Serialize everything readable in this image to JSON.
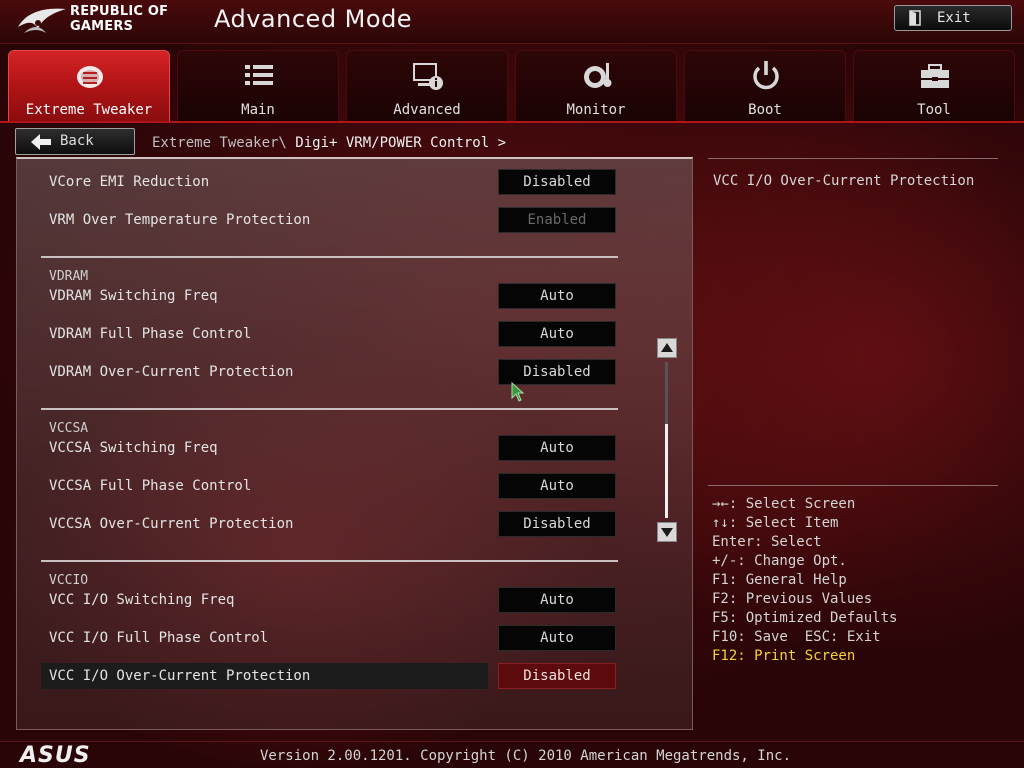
{
  "header": {
    "brand_line1": "REPUBLIC OF",
    "brand_line2": "GAMERS",
    "title": "Advanced Mode",
    "exit_label": "Exit"
  },
  "tabs": [
    {
      "label": "Extreme Tweaker",
      "icon": "extreme-tweaker-icon",
      "active": true
    },
    {
      "label": "Main",
      "icon": "list-icon",
      "active": false
    },
    {
      "label": "Advanced",
      "icon": "advanced-settings-icon",
      "active": false
    },
    {
      "label": "Monitor",
      "icon": "monitor-gauge-icon",
      "active": false
    },
    {
      "label": "Boot",
      "icon": "power-icon",
      "active": false
    },
    {
      "label": "Tool",
      "icon": "toolbox-icon",
      "active": false
    }
  ],
  "nav": {
    "back_label": "Back",
    "breadcrumb_parent": "Extreme Tweaker\\ ",
    "breadcrumb_current": "Digi+ VRM/POWER Control >"
  },
  "settings": {
    "vcore": [
      {
        "label": "VCore EMI Reduction",
        "value": "Disabled",
        "enabled": true
      },
      {
        "label": "VRM Over Temperature Protection",
        "value": "Enabled",
        "enabled": false
      }
    ],
    "vdram_group": "VDRAM",
    "vdram": [
      {
        "label": "VDRAM Switching Freq",
        "value": "Auto"
      },
      {
        "label": "VDRAM Full Phase Control",
        "value": "Auto"
      },
      {
        "label": "VDRAM Over-Current Protection",
        "value": "Disabled"
      }
    ],
    "vccsa_group": "VCCSA",
    "vccsa": [
      {
        "label": "VCCSA Switching Freq",
        "value": "Auto"
      },
      {
        "label": "VCCSA Full Phase Control",
        "value": "Auto"
      },
      {
        "label": "VCCSA Over-Current Protection",
        "value": "Disabled"
      }
    ],
    "vccio_group": "VCCIO",
    "vccio": [
      {
        "label": "VCC I/O Switching Freq",
        "value": "Auto"
      },
      {
        "label": "VCC I/O Full Phase Control",
        "value": "Auto"
      },
      {
        "label": "VCC I/O Over-Current Protection",
        "value": "Disabled",
        "selected": true
      }
    ]
  },
  "help": {
    "description": "VCC I/O Over-Current Protection",
    "keys": [
      "→←: Select Screen",
      "↑↓: Select Item",
      "Enter: Select",
      "+/-: Change Opt.",
      "F1: General Help",
      "F2: Previous Values",
      "F5: Optimized Defaults",
      "F10: Save  ESC: Exit",
      "F12: Print Screen"
    ]
  },
  "footer": {
    "text": "Version 2.00.1201. Copyright (C) 2010 American Megatrends, Inc."
  },
  "colors": {
    "accent": "#b01416",
    "selected_value_bg": "#5d0a0c",
    "hotkey_highlight": "#f4d23a"
  }
}
